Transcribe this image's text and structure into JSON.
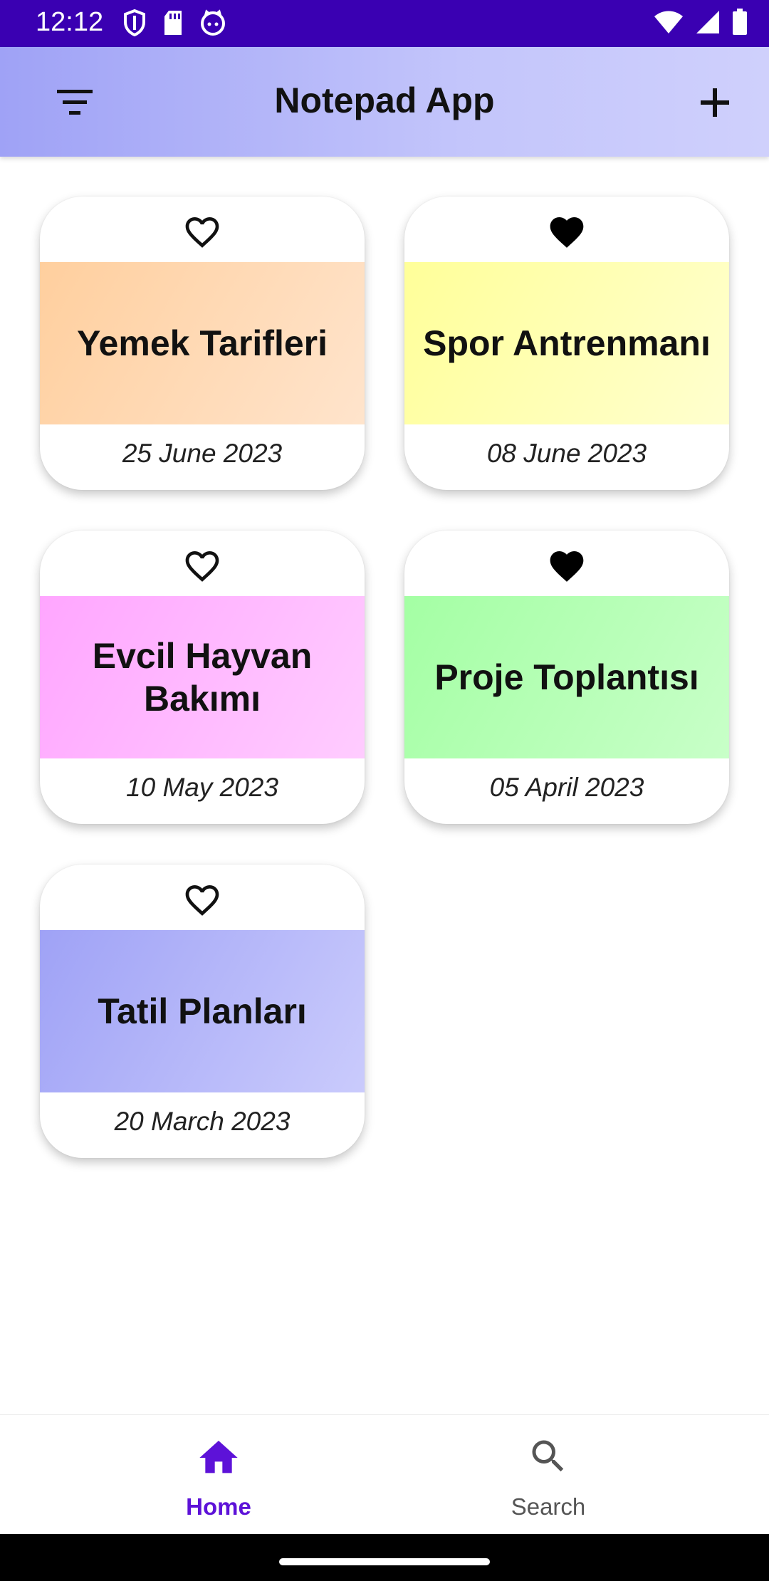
{
  "status_bar": {
    "time": "12:12",
    "left_icons": [
      "shield-icon",
      "sd-card-icon",
      "cat-icon"
    ],
    "right_icons": [
      "wifi-icon",
      "signal-icon",
      "battery-icon"
    ],
    "color": "#3a00b2"
  },
  "app_bar": {
    "title": "Notepad App",
    "left_icon": "filter-icon",
    "right_icon": "plus-icon"
  },
  "notes": [
    {
      "title": "Yemek Tarifleri",
      "date": "25 June 2023",
      "favorite": false,
      "colors": [
        "#ffcf9e",
        "#ffe4cc"
      ]
    },
    {
      "title": "Spor Antrenmanı",
      "date": "08 June 2023",
      "favorite": true,
      "colors": [
        "#ffff99",
        "#ffffcf"
      ]
    },
    {
      "title": "Evcil Hayvan Bakımı",
      "date": "10 May 2023",
      "favorite": false,
      "colors": [
        "#ffa6ff",
        "#ffccff"
      ]
    },
    {
      "title": "Proje Toplantısı",
      "date": "05 April 2023",
      "favorite": true,
      "colors": [
        "#a4ffa4",
        "#c8ffc8"
      ]
    },
    {
      "title": "Tatil Planları",
      "date": "20 March 2023",
      "favorite": false,
      "colors": [
        "#9fa2f6",
        "#cacbfc"
      ]
    }
  ],
  "bottom_nav": {
    "items": [
      {
        "label": "Home",
        "icon": "home-icon",
        "active": true
      },
      {
        "label": "Search",
        "icon": "search-icon",
        "active": false
      }
    ],
    "active_color": "#5d12d8",
    "inactive_color": "#555555"
  }
}
